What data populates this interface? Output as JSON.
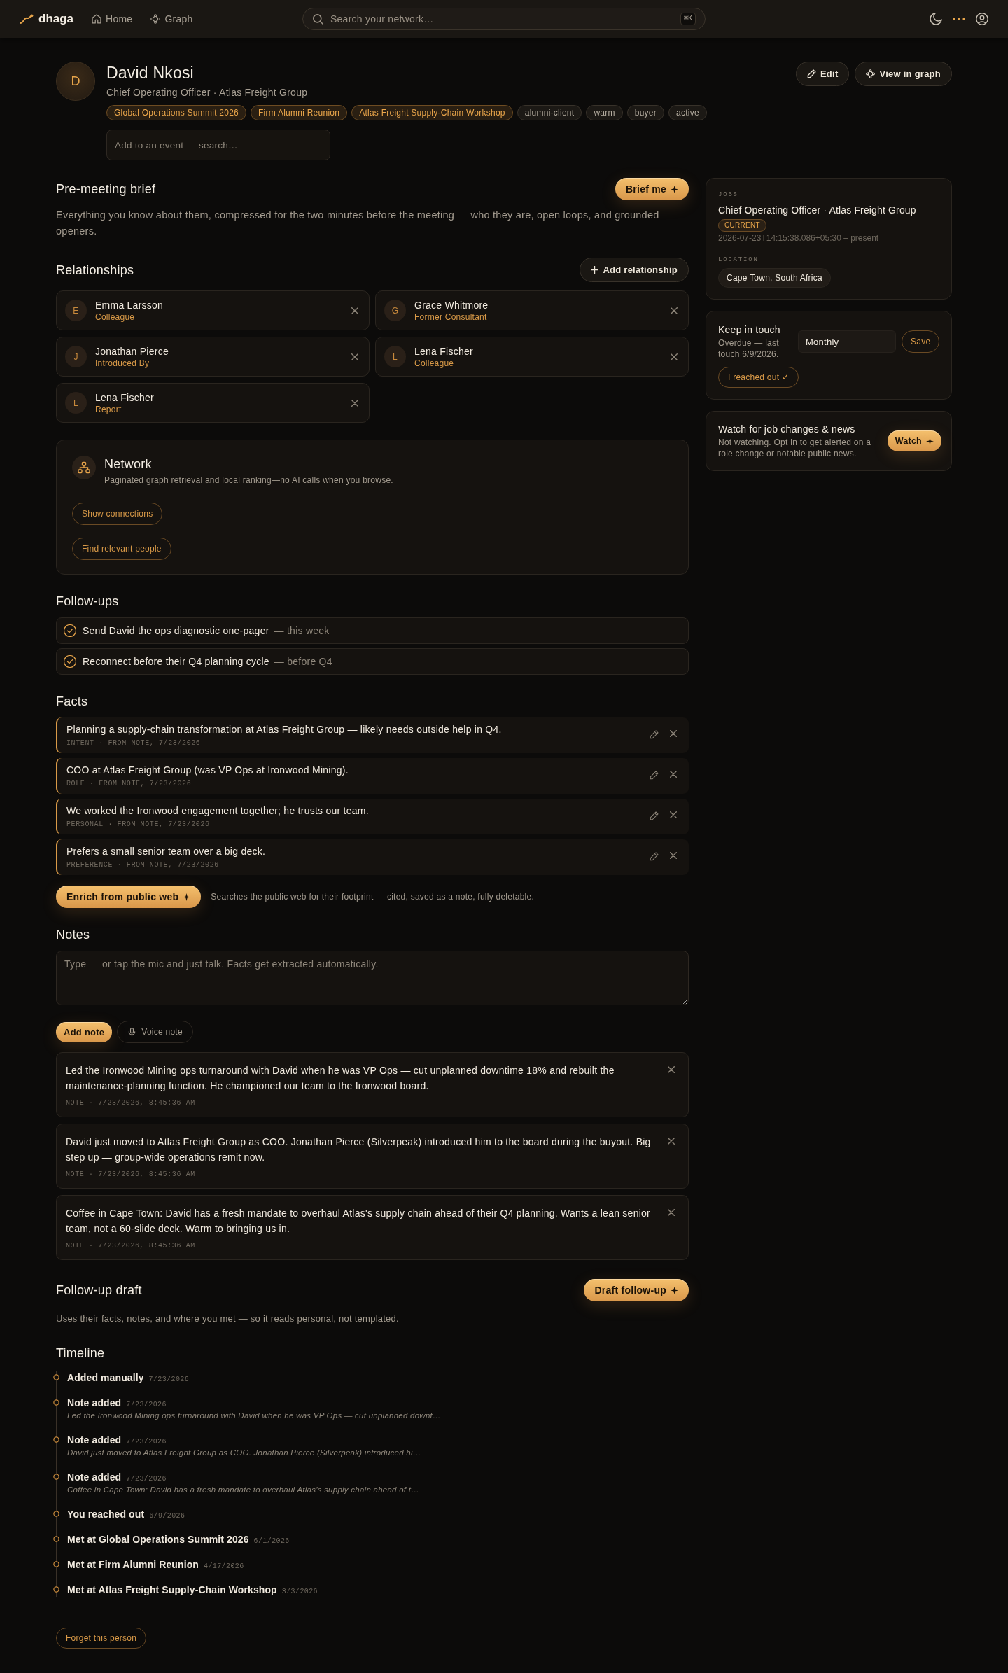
{
  "nav": {
    "brand": "dhaga",
    "home": "Home",
    "graph": "Graph",
    "search": {
      "placeholder": "Search your network…",
      "shortcut": "⌘K"
    }
  },
  "profile": {
    "initial": "D",
    "name": "David Nkosi",
    "subtitle": "Chief Operating Officer · Atlas Freight Group",
    "tags": [
      {
        "label": "Global Operations Summit 2026",
        "kind": "event"
      },
      {
        "label": "Firm Alumni Reunion",
        "kind": "event"
      },
      {
        "label": "Atlas Freight Supply-Chain Workshop",
        "kind": "event"
      },
      {
        "label": "alumni-client",
        "kind": "tag"
      },
      {
        "label": "warm",
        "kind": "tag"
      },
      {
        "label": "buyer",
        "kind": "tag"
      },
      {
        "label": "active",
        "kind": "tag"
      }
    ],
    "event_search": {
      "placeholder": "Add to an event — search…"
    },
    "edit": "Edit",
    "view_graph": "View in graph"
  },
  "brief": {
    "title": "Pre-meeting brief",
    "button": "Brief me",
    "description": "Everything you know about them, compressed for the two minutes before the meeting — who they are, open loops, and grounded openers."
  },
  "relationships": {
    "title": "Relationships",
    "add_button": "Add relationship",
    "items": [
      {
        "initial": "E",
        "name": "Emma Larsson",
        "role": "Colleague"
      },
      {
        "initial": "G",
        "name": "Grace Whitmore",
        "role": "Former Consultant"
      },
      {
        "initial": "J",
        "name": "Jonathan Pierce",
        "role": "Introduced By"
      },
      {
        "initial": "L",
        "name": "Lena Fischer",
        "role": "Colleague"
      },
      {
        "initial": "L",
        "name": "Lena Fischer",
        "role": "Report"
      }
    ]
  },
  "network": {
    "title": "Network",
    "description": "Paginated graph retrieval and local ranking—no AI calls when you browse.",
    "buttons": [
      "Show connections",
      "Find relevant people"
    ]
  },
  "follow_ups": {
    "title": "Follow-ups",
    "items": [
      {
        "text": "Send David the ops diagnostic one-pager",
        "due": "— this week"
      },
      {
        "text": "Reconnect before their Q4 planning cycle",
        "due": "— before Q4"
      }
    ]
  },
  "facts": {
    "title": "Facts",
    "items": [
      {
        "text": "Planning a supply-chain transformation at Atlas Freight Group — likely needs outside help in Q4.",
        "meta": "INTENT · FROM NOTE, 7/23/2026"
      },
      {
        "text": "COO at Atlas Freight Group (was VP Ops at Ironwood Mining).",
        "meta": "ROLE · FROM NOTE, 7/23/2026"
      },
      {
        "text": "We worked the Ironwood engagement together; he trusts our team.",
        "meta": "PERSONAL · FROM NOTE, 7/23/2026"
      },
      {
        "text": "Prefers a small senior team over a big deck.",
        "meta": "PREFERENCE · FROM NOTE, 7/23/2026"
      }
    ],
    "enrich_button": "Enrich from public web",
    "enrich_hint": "Searches the public web for their footprint — cited, saved as a note, fully deletable."
  },
  "notes": {
    "title": "Notes",
    "placeholder": "Type — or tap the mic and just talk. Facts get extracted automatically.",
    "add_button": "Add note",
    "voice_button": "Voice note",
    "items": [
      {
        "text": "Led the Ironwood Mining ops turnaround with David when he was VP Ops — cut unplanned downtime 18% and rebuilt the maintenance-planning function. He championed our team to the Ironwood board.",
        "meta": "NOTE · 7/23/2026, 8:45:36 AM"
      },
      {
        "text": "David just moved to Atlas Freight Group as COO. Jonathan Pierce (Silverpeak) introduced him to the board during the buyout. Big step up — group-wide operations remit now.",
        "meta": "NOTE · 7/23/2026, 8:45:36 AM"
      },
      {
        "text": "Coffee in Cape Town: David has a fresh mandate to overhaul Atlas's supply chain ahead of their Q4 planning. Wants a lean senior team, not a 60-slide deck. Warm to bringing us in.",
        "meta": "NOTE · 7/23/2026, 8:45:36 AM"
      }
    ]
  },
  "draft": {
    "title": "Follow-up draft",
    "button": "Draft follow-up",
    "description": "Uses their facts, notes, and where you met — so it reads personal, not templated."
  },
  "timeline": {
    "title": "Timeline",
    "items": [
      {
        "title": "Added manually",
        "date": "7/23/2026"
      },
      {
        "title": "Note added",
        "date": "7/23/2026",
        "excerpt": "Led the Ironwood Mining ops turnaround with David when he was VP Ops — cut unplanned downt…"
      },
      {
        "title": "Note added",
        "date": "7/23/2026",
        "excerpt": "David just moved to Atlas Freight Group as COO. Jonathan Pierce (Silverpeak) introduced hi…"
      },
      {
        "title": "Note added",
        "date": "7/23/2026",
        "excerpt": "Coffee in Cape Town: David has a fresh mandate to overhaul Atlas's supply chain ahead of t…"
      },
      {
        "title": "You reached out",
        "date": "6/9/2026"
      },
      {
        "title": "Met at Global Operations Summit 2026",
        "date": "6/1/2026"
      },
      {
        "title": "Met at Firm Alumni Reunion",
        "date": "4/17/2026"
      },
      {
        "title": "Met at Atlas Freight Supply-Chain Workshop",
        "date": "3/3/2026"
      }
    ]
  },
  "forget_button": "Forget this person",
  "jobs": {
    "label": "JOBS",
    "title": "Chief Operating Officer · Atlas Freight Group",
    "badge": "CURRENT",
    "dates": "2026-07-23T14:15:38.086+05:30 – present",
    "location_label": "LOCATION",
    "location": "Cape Town, South Africa"
  },
  "keep_in_touch": {
    "title": "Keep in touch",
    "status": "Overdue — last touch 6/9/2026.",
    "frequency": "Monthly",
    "save": "Save",
    "reached_out": "I reached out ✓"
  },
  "watch": {
    "title": "Watch for job changes & news",
    "description": "Not watching. Opt in to get alerted on a role change or notable public news.",
    "button": "Watch"
  }
}
